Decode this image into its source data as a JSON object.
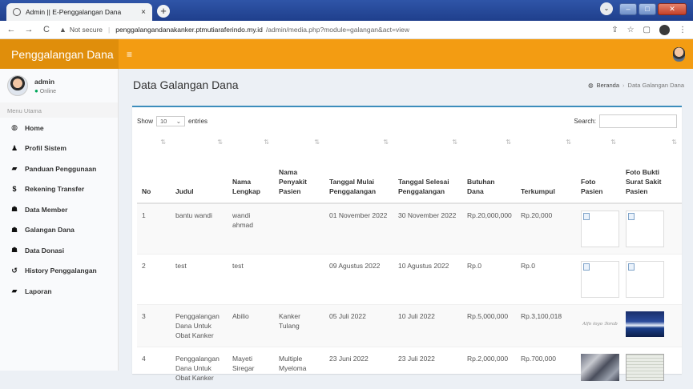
{
  "browser": {
    "tab_title": "Admin || E-Penggalangan Dana",
    "tab_close": "×",
    "new_tab": "+",
    "not_secure": "Not secure",
    "url_host": "penggalangandanakanker.ptmutiaraferindo.my.id",
    "url_path": "/admin/media.php?module=galangan&act=view"
  },
  "app": {
    "logo": "Penggalangan Dana",
    "menu_toggle": "≡"
  },
  "user": {
    "name": "admin",
    "status": "Online"
  },
  "sidebar": {
    "header": "Menu Utama",
    "items": [
      {
        "label": "Home",
        "icon": "dashboard-icon"
      },
      {
        "label": "Profil Sistem",
        "icon": "user-icon"
      },
      {
        "label": "Panduan Penggunaan",
        "icon": "book-icon"
      },
      {
        "label": "Rekening Transfer",
        "icon": "dollar-icon"
      },
      {
        "label": "Data Member",
        "icon": "users-icon"
      },
      {
        "label": "Galangan Dana",
        "icon": "users-icon"
      },
      {
        "label": "Data Donasi",
        "icon": "users-icon"
      },
      {
        "label": "History Penggalangan",
        "icon": "history-icon"
      },
      {
        "label": "Laporan",
        "icon": "book-icon"
      }
    ]
  },
  "page": {
    "title": "Data Galangan Dana",
    "breadcrumb_home": "Beranda",
    "breadcrumb_current": "Data Galangan Dana"
  },
  "datatable": {
    "show_label": "Show",
    "length_value": "10",
    "entries_label": "entries",
    "search_label": "Search:",
    "columns": [
      "No",
      "Judul",
      "Nama Lengkap",
      "Nama Penyakit Pasien",
      "Tanggal Mulai Penggalangan",
      "Tanggal Selesai Penggalangan",
      "Butuhan Dana",
      "Terkumpul",
      "Foto Pasien",
      "Foto Bukti Surat Sakit Pasien"
    ],
    "rows": [
      {
        "no": "1",
        "judul": "bantu wandi",
        "nama": "wandi ahmad",
        "penyakit": "",
        "mulai": "01 November 2022",
        "selesai": "30 November 2022",
        "butuhan": "Rp.20,000,000",
        "terkumpul": "Rp.20,000"
      },
      {
        "no": "2",
        "judul": "test",
        "nama": "test",
        "penyakit": "",
        "mulai": "09 Agustus 2022",
        "selesai": "10 Agustus 2022",
        "butuhan": "Rp.0",
        "terkumpul": "Rp.0"
      },
      {
        "no": "3",
        "judul": "Penggalangan Dana Untuk Obat Kanker",
        "nama": "Abilio",
        "penyakit": "Kanker Tulang",
        "mulai": "05 Juli 2022",
        "selesai": "10 Juli 2022",
        "butuhan": "Rp.5,000,000",
        "terkumpul": "Rp.3,100,018"
      },
      {
        "no": "4",
        "judul": "Penggalangan Dana Untuk Obat Kanker",
        "nama": "Mayeti Siregar",
        "penyakit": "Multiple Myeloma",
        "mulai": "23 Juni 2022",
        "selesai": "23 Juli 2022",
        "butuhan": "Rp.2,000,000",
        "terkumpul": "Rp.700,000"
      }
    ]
  }
}
